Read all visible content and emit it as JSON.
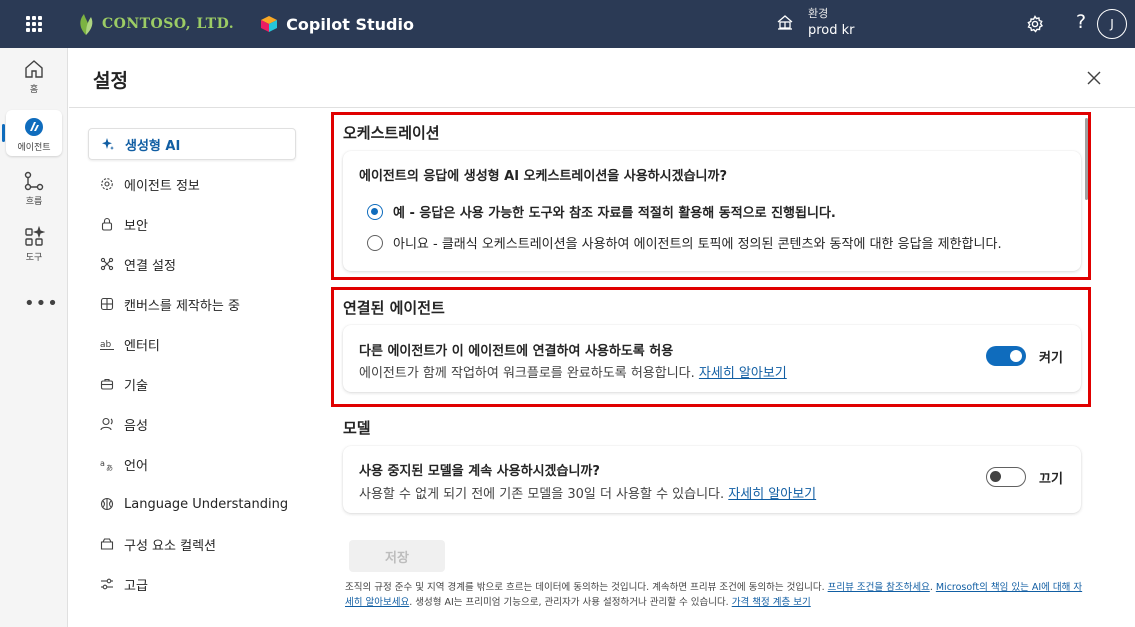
{
  "header": {
    "org_name": "CONTOSO, LTD.",
    "app_title": "Copilot Studio",
    "env_label": "환경",
    "env_value": "prod kr",
    "help_label": "?",
    "avatar_initial": "J"
  },
  "rail": {
    "items": [
      {
        "label": "홈",
        "icon": "home-icon"
      },
      {
        "label": "에이전트",
        "icon": "agent-icon"
      },
      {
        "label": "흐름",
        "icon": "flow-icon"
      },
      {
        "label": "도구",
        "icon": "tools-icon"
      }
    ],
    "more_label": "•••"
  },
  "page": {
    "title": "설정"
  },
  "nav": {
    "items": [
      {
        "label": "생성형 AI",
        "icon": "sparkle-icon"
      },
      {
        "label": "에이전트 정보",
        "icon": "gear-icon"
      },
      {
        "label": "보안",
        "icon": "lock-icon"
      },
      {
        "label": "연결 설정",
        "icon": "connect-icon"
      },
      {
        "label": "캔버스를 제작하는 중",
        "icon": "grid-icon"
      },
      {
        "label": "엔터티",
        "icon": "entity-icon"
      },
      {
        "label": "기술",
        "icon": "briefcase-icon"
      },
      {
        "label": "음성",
        "icon": "voice-icon"
      },
      {
        "label": "언어",
        "icon": "language-icon"
      },
      {
        "label": "Language Understanding",
        "icon": "brain-icon"
      },
      {
        "label": "구성 요소 컬렉션",
        "icon": "collection-icon"
      },
      {
        "label": "고급",
        "icon": "sliders-icon"
      }
    ]
  },
  "orchestration": {
    "title": "오케스트레이션",
    "question": "에이전트의 응답에 생성형 AI 오케스트레이션을 사용하시겠습니까?",
    "option_yes": "예 - 응답은 사용 가능한 도구와 참조 자료를 적절히 활용해 동적으로 진행됩니다.",
    "option_no": "아니요 - 클래식 오케스트레이션을 사용하여 에이전트의 토픽에 정의된 콘텐츠와 동작에 대한 응답을 제한합니다.",
    "selected": "yes"
  },
  "connected_agents": {
    "title": "연결된 에이전트",
    "question": "다른 에이전트가 이 에이전트에 연결하여 사용하도록 허용",
    "description": "에이전트가 함께 작업하여 워크플로를 완료하도록 허용합니다.",
    "link": "자세히 알아보기",
    "toggle_label": "켜기",
    "toggle_on": true
  },
  "model": {
    "title": "모델",
    "question": "사용 중지된 모델을 계속 사용하시겠습니까?",
    "description": "사용할 수 없게 되기 전에 기존 모델을 30일 더 사용할 수 있습니다.",
    "link": "자세히 알아보기",
    "toggle_label": "끄기",
    "toggle_on": false
  },
  "save_label": "저장",
  "footer": {
    "text1": "조직의 규정 준수 및 지역 경계를 밖으로 흐르는 데이터에 동의하는 것입니다. 계속하면 프리뷰 조건에 동의하는 것입니다. ",
    "link1": "프리뷰 조건을 참조하세요",
    "text2": ". ",
    "link2": "Microsoft의 책임 있는 AI에 대해 자세히 알아보세요",
    "text3": ". 생성형 AI는 프리미엄 기능으로, 관리자가 사용 설정하거나 관리할 수 있습니다. ",
    "link3": "가격 책정 계층 보기"
  },
  "colors": {
    "topbar": "#2b3a55",
    "accent": "#0f6cbd",
    "highlight_box": "#e00000"
  }
}
